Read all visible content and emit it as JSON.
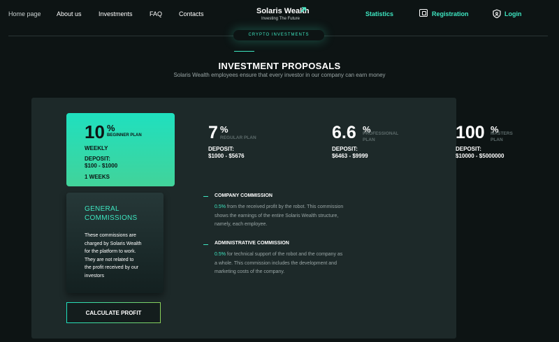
{
  "nav": {
    "home": "Home page",
    "about": "About us",
    "investments": "Investments",
    "faq": "FAQ",
    "contacts": "Contacts",
    "statistics": "Statistics",
    "registration": "Registration",
    "login": "Login"
  },
  "logo": {
    "title": "Solaris Wealth",
    "subtitle": "Investing The Future"
  },
  "section_pill": "CRYPTO INVESTMENTS",
  "heading": {
    "title": "INVESTMENT PROPOSALS",
    "subtitle": "Solaris Wealth employees ensure that every investor in our company can earn money"
  },
  "beginner": {
    "percent": "10",
    "percent_sign": "%",
    "plan": "BEGINNER PLAN",
    "period": "WEEKLY",
    "deposit_label": "DEPOSIT:",
    "deposit_value": "$100 - $1000",
    "duration": "1 WEEKS"
  },
  "plans": [
    {
      "percent": "7",
      "percent_sign": "%",
      "plan_line1": "REGULAR PLAN",
      "plan_line2": "",
      "deposit_label": "DEPOSIT:",
      "deposit_value": "$1000 - $5676"
    },
    {
      "percent": "6.6",
      "percent_sign": "%",
      "plan_line1": "PROFESSIONAL",
      "plan_line2": "PLAN",
      "deposit_label": "DEPOSIT:",
      "deposit_value": "$6463 - $9999"
    },
    {
      "percent": "100",
      "percent_sign": "%",
      "plan_line1": "MASTERS",
      "plan_line2": "PLAN",
      "deposit_label": "DEPOSIT:",
      "deposit_value": "$10000 - $5000000"
    }
  ],
  "general": {
    "title_line1": "GENERAL",
    "title_line2": "COMMISSIONS",
    "text_lines": [
      "These commissions are",
      "charged by Solaris Wealth",
      "for the platform to work.",
      "They are not related to",
      "the profit received by our",
      "investors"
    ]
  },
  "calculate_button": "CALCULATE PROFIT",
  "commissions": [
    {
      "title": "COMPANY COMMISSION",
      "rate": "0.5%",
      "line1": " from the received profit by the robot. This commission",
      "line2": "shows the earnings of the entire Solaris Wealth structure,",
      "line3": "namely, each employee."
    },
    {
      "title": "ADMINISTRATIVE COMMISSION",
      "rate": "0.5%",
      "line1": " for technical support of the robot and the company as",
      "line2": "a whole. This commission includes the development and",
      "line3": "marketing costs of the company."
    }
  ],
  "colors": {
    "accent": "#3ee6c1",
    "background": "#0d1414",
    "panel": "#1d2929"
  }
}
